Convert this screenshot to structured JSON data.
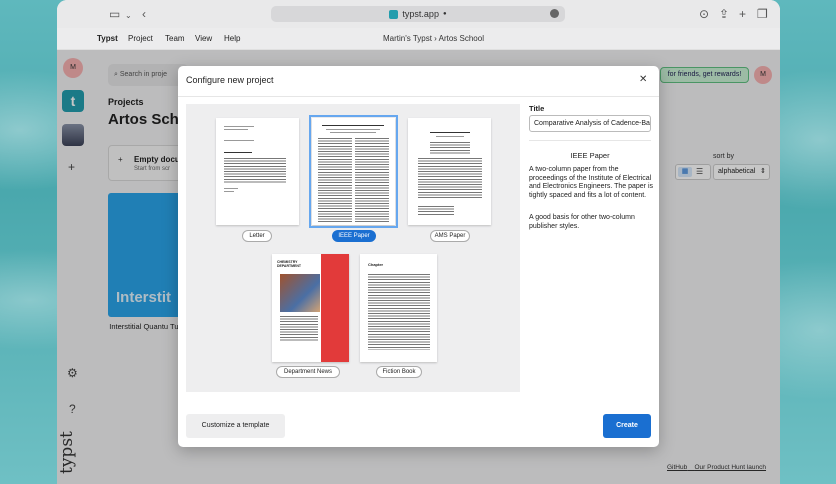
{
  "browser": {
    "url": "typst.app",
    "lock": "🔒"
  },
  "menu": [
    "Typst",
    "Project",
    "Team",
    "View",
    "Help"
  ],
  "breadcrumb": "Martin's Typst › Artos School",
  "sidebar": {
    "avatar": "M",
    "project_initial": "t"
  },
  "page": {
    "search_placeholder": "Search in proje",
    "projects_heading": "Projects",
    "school_heading": "Artos Scho",
    "empty_doc_title": "Empty docu",
    "empty_doc_sub": "Start from scr",
    "project_card_title": "Interstit",
    "project_card_name": "Interstitial Quantu Tunneling",
    "rewards": "for friends, get rewards!",
    "avatar": "M",
    "sort_by_label": "sort by",
    "sort_value": "alphabetical",
    "footer_github": "GitHub",
    "footer_producthunt": "Our Product Hunt launch"
  },
  "modal": {
    "title": "Configure new project",
    "templates": [
      {
        "label": "Letter",
        "selected": false
      },
      {
        "label": "IEEE Paper",
        "selected": true
      },
      {
        "label": "AMS Paper",
        "selected": false
      },
      {
        "label": "Department News",
        "selected": false
      },
      {
        "label": "Fiction Book",
        "selected": false
      }
    ],
    "dept_cover_heading": "CHEMISTRY DEPARTMENT",
    "fiction_heading": "Chapter",
    "title_label": "Title",
    "title_value": "Comparative Analysis of Cadence-Ba",
    "desc_title": "IEEE Paper",
    "desc_p1": "A two-column paper from the proceedings of the Institute of Electrical and Electronics Engineers. The paper is tightly spaced and fits a lot of content.",
    "desc_p2": "A good basis for other two-column publisher styles.",
    "customize_button": "Customize a template",
    "create_button": "Create"
  }
}
